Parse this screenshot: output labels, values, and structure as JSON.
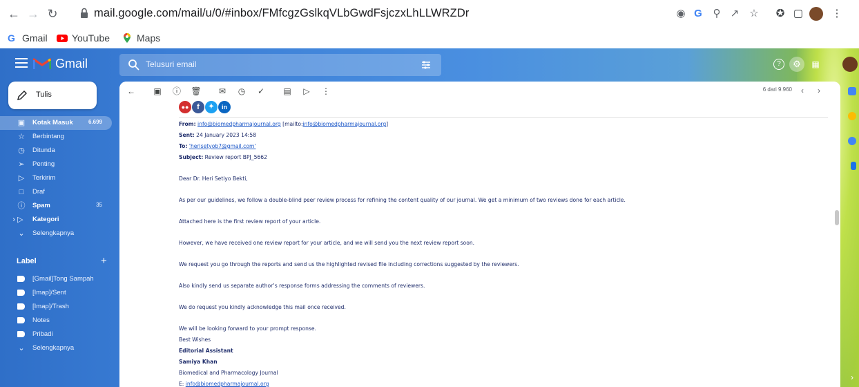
{
  "browser": {
    "url": "mail.google.com/mail/u/0/#inbox/FMfcgzGslkqVLbGwdFsjczxLhLLWRZDr",
    "bookmarks": [
      {
        "label": "Gmail",
        "icon": "google-icon"
      },
      {
        "label": "YouTube",
        "icon": "youtube-icon"
      },
      {
        "label": "Maps",
        "icon": "maps-icon"
      }
    ]
  },
  "gmail": {
    "app_name": "Gmail",
    "search_placeholder": "Telusuri email",
    "compose_label": "Tulis",
    "nav": [
      {
        "label": "Kotak Masuk",
        "count": "6.699",
        "icon": "inbox-icon",
        "active": true,
        "bold": true
      },
      {
        "label": "Berbintang",
        "count": "",
        "icon": "star-icon"
      },
      {
        "label": "Ditunda",
        "count": "",
        "icon": "clock-icon"
      },
      {
        "label": "Penting",
        "count": "",
        "icon": "important-icon"
      },
      {
        "label": "Terkirim",
        "count": "",
        "icon": "send-icon"
      },
      {
        "label": "Draf",
        "count": "",
        "icon": "draft-icon"
      },
      {
        "label": "Spam",
        "count": "35",
        "icon": "spam-icon",
        "bold": true
      },
      {
        "label": "Kategori",
        "count": "",
        "icon": "label-icon",
        "bold": true
      },
      {
        "label": "Selengkapnya",
        "count": "",
        "icon": "chevron-down-icon"
      }
    ],
    "labels_heading": "Label",
    "labels": [
      {
        "label": "[Gmail]Tong Sampah"
      },
      {
        "label": "[Imap]/Sent"
      },
      {
        "label": "[Imap]/Trash"
      },
      {
        "label": "Notes"
      },
      {
        "label": "Pribadi"
      }
    ],
    "labels_more": "Selengkapnya",
    "pager": "6 dari 9.960"
  },
  "email": {
    "social_icons": [
      "people-icon",
      "facebook-icon",
      "twitter-icon",
      "linkedin-icon"
    ],
    "from_label": "From:",
    "from_email": "info@biomedpharmajournal.org",
    "mailto_prefix": "[mailto:",
    "mailto_email": "info@biomedpharmajournal.org",
    "mailto_suffix": "]",
    "sent_label": "Sent:",
    "sent_value": "24 January 2023 14:58",
    "to_label": "To:",
    "to_value": "'herisetyob7@gmail.com'",
    "subject_label": "Subject:",
    "subject_value": "Review report BPJ_5662",
    "greeting": "Dear Dr. Heri Setiyo Bekti,",
    "paragraphs": [
      "As per our guidelines, we follow a double-blind peer review process for refining the content quality of our journal. We get a minimum of two reviews done for each article.",
      "Attached here is the first review report of your article.",
      "However, we have received one review report for your article, and we will send you the next review report soon.",
      "We request you go through the reports and send us the highlighted revised file including corrections suggested by the reviewers.",
      "Also kindly send us separate author’s response forms addressing the comments of reviewers.",
      "We do request you kindly acknowledge this mail once received."
    ],
    "closing": "We will be looking forward to your prompt response.",
    "wishes": "Best Wishes",
    "role": "Editorial Assistant",
    "name": "Samiya Khan",
    "org": "Biomedical and Pharmacology Journal",
    "email_prefix": "E: ",
    "email_link": "info@biomedpharmajournal.org"
  },
  "colors": {
    "gmail_blue": "#3b7ed6",
    "gmail_red": "#ea4335",
    "link": "#1a56c7",
    "text": "#1f2d6b"
  }
}
